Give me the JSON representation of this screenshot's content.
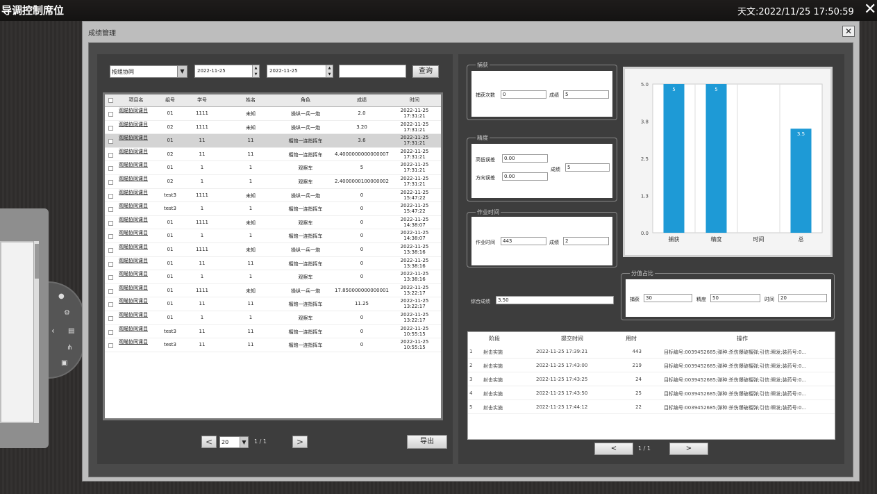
{
  "app": {
    "title": "导调控制席位",
    "clock": "天文:2022/11/25  17:50:59",
    "close_glyph": "✕"
  },
  "dialog": {
    "title": "成绩管理",
    "close_glyph": "✕"
  },
  "filter": {
    "dropdown_value": "按组协同",
    "start_date": "2022-11-25",
    "end_date": "2022-11-25",
    "keyword_value": "",
    "query_label": "查询"
  },
  "table": {
    "headers": [
      "项目名",
      "组号",
      "学号",
      "姓名",
      "角色",
      "成绩",
      "时间"
    ],
    "rows": [
      {
        "project": "观瞄协同课目",
        "group": "01",
        "id": "1111",
        "name": "未知",
        "role": "操纵一兵一炮",
        "score": "2.0",
        "time": "2022-11-25 17:31:21",
        "selected": false
      },
      {
        "project": "观瞄协同课目",
        "group": "02",
        "id": "1111",
        "name": "未知",
        "role": "操纵一兵一炮",
        "score": "3.20",
        "time": "2022-11-25 17:31:21",
        "selected": false
      },
      {
        "project": "观瞄协同课目",
        "group": "01",
        "id": "11",
        "name": "11",
        "role": "榴炮一连指挥车",
        "score": "3.6",
        "time": "2022-11-25 17:31:21",
        "selected": true
      },
      {
        "project": "观瞄协同课目",
        "group": "02",
        "id": "11",
        "name": "11",
        "role": "榴炮一连指挥车",
        "score": "4.4000000000000007",
        "time": "2022-11-25 17:31:21",
        "selected": false
      },
      {
        "project": "观瞄协同课目",
        "group": "01",
        "id": "1",
        "name": "1",
        "role": "观察车",
        "score": "5",
        "time": "2022-11-25 17:31:21",
        "selected": false
      },
      {
        "project": "观瞄协同课目",
        "group": "02",
        "id": "1",
        "name": "1",
        "role": "观察车",
        "score": "2.4000000100000002",
        "time": "2022-11-25 17:31:21",
        "selected": false
      },
      {
        "project": "观瞄协同课目",
        "group": "test3",
        "id": "1111",
        "name": "未知",
        "role": "操纵一兵一炮",
        "score": "0",
        "time": "2022-11-25 15:47:22",
        "selected": false
      },
      {
        "project": "观瞄协同课目",
        "group": "test3",
        "id": "1",
        "name": "1",
        "role": "榴炮一连指挥车",
        "score": "0",
        "time": "2022-11-25 15:47:22",
        "selected": false
      },
      {
        "project": "观瞄协同课目",
        "group": "01",
        "id": "1111",
        "name": "未知",
        "role": "观察车",
        "score": "0",
        "time": "2022-11-25 14:38:07",
        "selected": false
      },
      {
        "project": "观瞄协同课目",
        "group": "01",
        "id": "1",
        "name": "1",
        "role": "榴炮一连指挥车",
        "score": "0",
        "time": "2022-11-25 14:38:07",
        "selected": false
      },
      {
        "project": "观瞄协同课目",
        "group": "01",
        "id": "1111",
        "name": "未知",
        "role": "操纵一兵一炮",
        "score": "0",
        "time": "2022-11-25 13:38:16",
        "selected": false
      },
      {
        "project": "观瞄协同课目",
        "group": "01",
        "id": "11",
        "name": "11",
        "role": "榴炮一连指挥车",
        "score": "0",
        "time": "2022-11-25 13:38:16",
        "selected": false
      },
      {
        "project": "观瞄协同课目",
        "group": "01",
        "id": "1",
        "name": "1",
        "role": "观察车",
        "score": "0",
        "time": "2022-11-25 13:38:16",
        "selected": false
      },
      {
        "project": "观瞄协同课目",
        "group": "01",
        "id": "1111",
        "name": "未知",
        "role": "操纵一兵一炮",
        "score": "17.850000000000001",
        "time": "2022-11-25 13:22:17",
        "selected": false
      },
      {
        "project": "观瞄协同课目",
        "group": "01",
        "id": "11",
        "name": "11",
        "role": "榴炮一连指挥车",
        "score": "11.25",
        "time": "2022-11-25 13:22:17",
        "selected": false
      },
      {
        "project": "观瞄协同课目",
        "group": "01",
        "id": "1",
        "name": "1",
        "role": "观察车",
        "score": "0",
        "time": "2022-11-25 13:22:17",
        "selected": false
      },
      {
        "project": "观瞄协同课目",
        "group": "test3",
        "id": "11",
        "name": "11",
        "role": "榴炮一连指挥车",
        "score": "0",
        "time": "2022-11-25 10:55:15",
        "selected": false
      },
      {
        "project": "观瞄协同课目",
        "group": "test3",
        "id": "11",
        "name": "11",
        "role": "榴炮一连指挥车",
        "score": "0",
        "time": "2022-11-25 10:55:15",
        "selected": false
      }
    ]
  },
  "left_pager": {
    "prev": "<",
    "page_size": "20",
    "page_info": "1  /  1",
    "next": ">",
    "export_label": "导出"
  },
  "stats": {
    "group1_title": "捕获",
    "capture_count_label": "捕获次数",
    "capture_count_value": "0",
    "capture_score_label": "成绩",
    "capture_score_value": "5",
    "group2_title": "精度",
    "height_error_label": "高低误差",
    "height_error_value": "0.00",
    "direction_error_label": "方向误差",
    "direction_error_value": "0.00",
    "precision_score_label": "成绩",
    "precision_score_value": "5",
    "group3_title": "作业时间",
    "work_time_label": "作业时间",
    "work_time_value": "443",
    "work_score_label": "成绩",
    "work_score_value": "2",
    "total_label": "综合成绩",
    "total_value": "3.50",
    "group4_title": "分值占比",
    "capture_ratio_label": "捕获",
    "capture_ratio_value": "30",
    "precision_ratio_label": "精度",
    "precision_ratio_value": "50",
    "time_ratio_label": "时间",
    "time_ratio_value": "20"
  },
  "chart_data": {
    "type": "bar",
    "categories": [
      "捕获",
      "精度",
      "时间",
      "总"
    ],
    "values": [
      5,
      5,
      0,
      3.5
    ],
    "data_labels": [
      "5",
      "5",
      "",
      "3.5"
    ],
    "ylim": [
      0,
      5
    ],
    "yticks": [
      "5.0",
      "3.8",
      "2.5",
      "1.3",
      "0.0"
    ],
    "bar_color": "#1e9ad6",
    "grid": true
  },
  "log": {
    "headers": [
      "阶段",
      "提交时间",
      "用时",
      "操作"
    ],
    "rows": [
      {
        "idx": "1",
        "stage": "射击实施",
        "time": "2022-11-25 17:39:21",
        "duration": "443",
        "op": "目标编号:0039452685;弹种:杀伤爆破榴弹;引信:瞬发;装药号:0..."
      },
      {
        "idx": "2",
        "stage": "射击实施",
        "time": "2022-11-25 17:43:00",
        "duration": "219",
        "op": "目标编号:0039452685;弹种:杀伤爆破榴弹;引信:瞬发;装药号:0..."
      },
      {
        "idx": "3",
        "stage": "射击实施",
        "time": "2022-11-25 17:43:25",
        "duration": "24",
        "op": "目标编号:0039452685;弹种:杀伤爆破榴弹;引信:瞬发;装药号:0..."
      },
      {
        "idx": "4",
        "stage": "射击实施",
        "time": "2022-11-25 17:43:50",
        "duration": "25",
        "op": "目标编号:0039452685;弹种:杀伤爆破榴弹;引信:瞬发;装药号:0..."
      },
      {
        "idx": "5",
        "stage": "射击实施",
        "time": "2022-11-25 17:44:12",
        "duration": "22",
        "op": "目标编号:0039452685;弹种:杀伤爆破榴弹;引信:瞬发;装药号:0..."
      }
    ]
  },
  "right_pager": {
    "prev": "<",
    "page_info": "1  /  1",
    "next": ">"
  }
}
